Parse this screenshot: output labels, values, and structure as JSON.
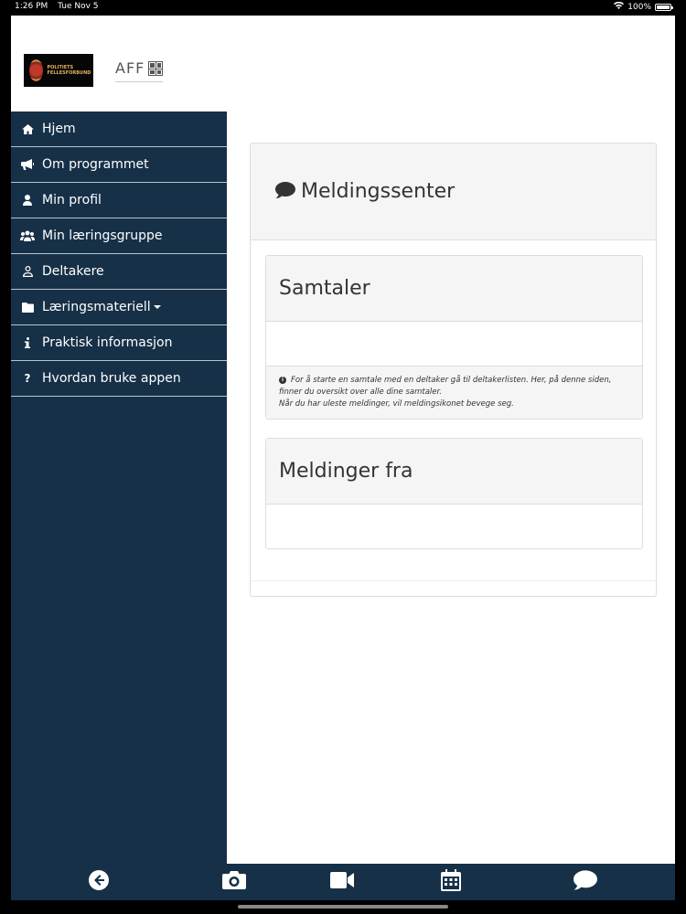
{
  "status_bar": {
    "time": "1:26 PM",
    "date": "Tue Nov 5",
    "battery": "100%",
    "battery_level": 1.0
  },
  "header": {
    "logo_left_text": "POLITIETS FELLESFORBUND",
    "logo_right_text": "AFF",
    "logo_right_icon": "grid-logo-icon"
  },
  "sidebar": {
    "items": [
      {
        "label": "Hjem",
        "icon": "home-icon"
      },
      {
        "label": "Om programmet",
        "icon": "bullhorn-icon"
      },
      {
        "label": "Min profil",
        "icon": "user-icon"
      },
      {
        "label": "Min læringsgruppe",
        "icon": "users-icon"
      },
      {
        "label": "Deltakere",
        "icon": "user-outline-icon"
      },
      {
        "label": "Læringsmateriell",
        "icon": "folder-icon"
      },
      {
        "label": "Praktisk informasjon",
        "icon": "info-icon"
      },
      {
        "label": "Hvordan bruke appen",
        "icon": "question-icon"
      }
    ]
  },
  "main": {
    "title": "Meldingssenter",
    "conversations": {
      "title": "Samtaler",
      "info_line1": "For å starte en samtale med en deltaker gå til deltakerlisten. Her, på denne siden, finner du oversikt over alle dine samtaler.",
      "info_line2": "Når du har uleste meldinger, vil meldingsikonet bevege seg."
    },
    "messages_from": {
      "title": "Meldinger fra"
    }
  },
  "bottom_bar": {
    "buttons": [
      "back-arrow-icon",
      "camera-icon",
      "video-icon",
      "calendar-icon",
      "chat-icon"
    ]
  },
  "colors": {
    "sidebar_bg": "#163047",
    "panel_bg": "#f5f5f5",
    "border": "#dddddd"
  }
}
